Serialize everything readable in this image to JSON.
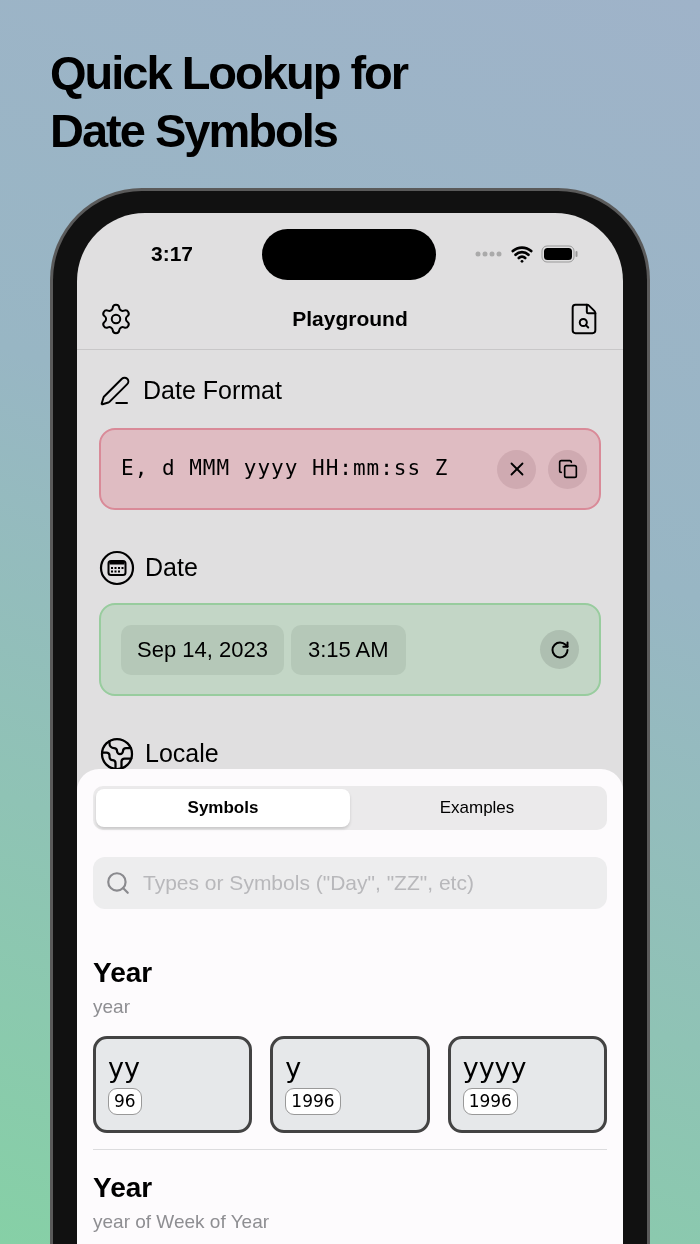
{
  "headline": "Quick Lookup for Date Symbols",
  "status_bar": {
    "time": "3:17"
  },
  "nav": {
    "title": "Playground"
  },
  "date_format": {
    "label": "Date Format",
    "value": "E, d MMM yyyy HH:mm:ss Z"
  },
  "date": {
    "label": "Date",
    "date": "Sep 14, 2023",
    "time": "3:15 AM"
  },
  "locale": {
    "label": "Locale"
  },
  "sheet": {
    "tabs": [
      {
        "label": "Symbols",
        "selected": true
      },
      {
        "label": "Examples",
        "selected": false
      }
    ],
    "search": {
      "placeholder": "Types or Symbols (\"Day\", \"ZZ\", etc)"
    },
    "groups": [
      {
        "title": "Year",
        "subtitle": "year",
        "symbols": [
          {
            "symbol": "yy",
            "example": "96"
          },
          {
            "symbol": "y",
            "example": "1996"
          },
          {
            "symbol": "yyyy",
            "example": "1996"
          }
        ]
      },
      {
        "title": "Year",
        "subtitle": "year of Week of Year"
      }
    ]
  }
}
